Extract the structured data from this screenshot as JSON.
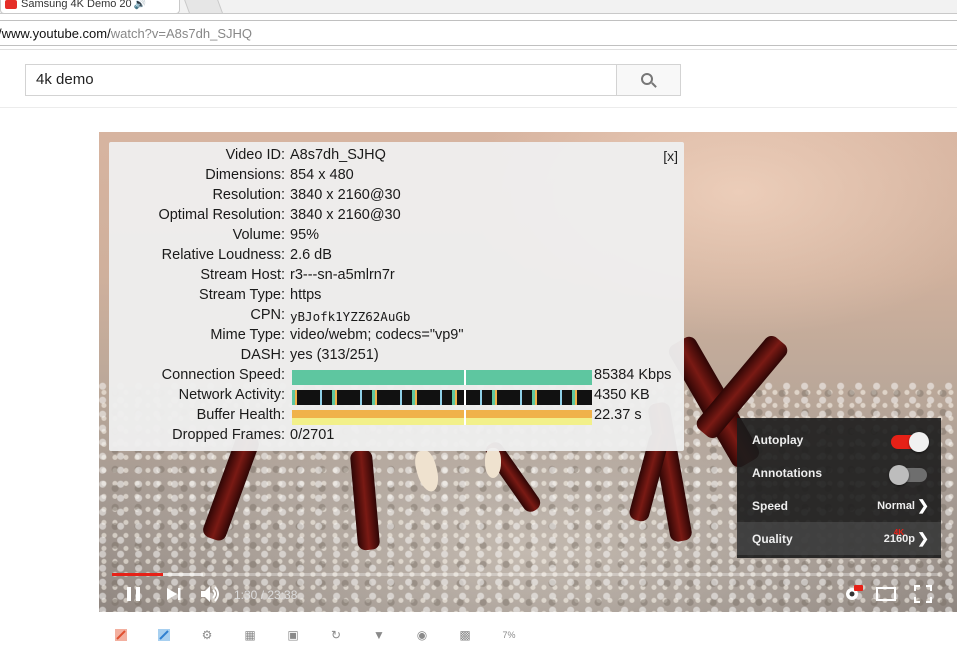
{
  "browser": {
    "tab_title": "Samsung 4K Demo 20",
    "url_host": "/www.youtube.com/",
    "url_rest": "watch?v=A8s7dh_SJHQ"
  },
  "search": {
    "query": "4k demo"
  },
  "stats": {
    "close_label": "[x]",
    "rows": [
      {
        "label": "Video ID:",
        "value": "A8s7dh_SJHQ"
      },
      {
        "label": "Dimensions:",
        "value": "854 x 480"
      },
      {
        "label": "Resolution:",
        "value": "3840 x 2160@30"
      },
      {
        "label": "Optimal Resolution:",
        "value": "3840 x 2160@30"
      },
      {
        "label": "Volume:",
        "value": "95%"
      },
      {
        "label": "Relative Loudness:",
        "value": "2.6 dB"
      },
      {
        "label": "Stream Host:",
        "value": "r3---sn-a5mlrn7r"
      },
      {
        "label": "Stream Type:",
        "value": "https"
      },
      {
        "label": "CPN:",
        "value": "yBJofk1YZZ62AuGb"
      },
      {
        "label": "Mime Type:",
        "value": "video/webm; codecs=\"vp9\""
      },
      {
        "label": "DASH:",
        "value": "yes (313/251)"
      },
      {
        "label": "Connection Speed:",
        "value": "85384 Kbps"
      },
      {
        "label": "Network Activity:",
        "value": "4350 KB"
      },
      {
        "label": "Buffer Health:",
        "value": "22.37 s"
      },
      {
        "label": "Dropped Frames:",
        "value": "0/2701"
      }
    ],
    "colors": {
      "connection": "#5ec6a0",
      "network": "#111111",
      "buffer_top": "#f0b24a",
      "buffer_bottom": "#f2f08a"
    }
  },
  "settings_menu": {
    "autoplay_label": "Autoplay",
    "autoplay_on": true,
    "annotations_label": "Annotations",
    "annotations_on": false,
    "speed_label": "Speed",
    "speed_value": "Normal",
    "quality_label": "Quality",
    "quality_value": "2160p",
    "quality_badge": "4K"
  },
  "player": {
    "current_time": "1:30",
    "duration": "23:38",
    "time_display": "1:30 / 23:38",
    "progress_fraction": 0.063,
    "accent": "#e62117"
  },
  "toolbar": {
    "zoom_label": "7%"
  }
}
